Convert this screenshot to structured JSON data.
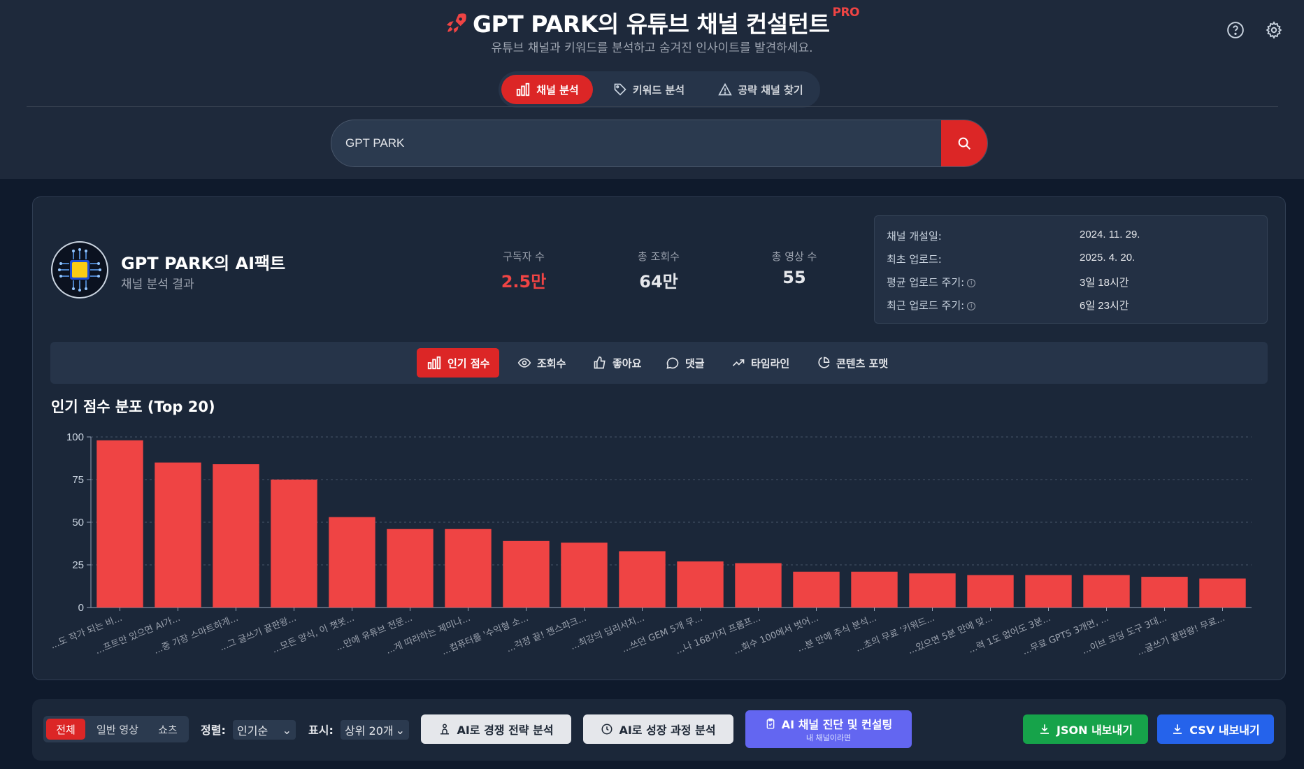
{
  "header": {
    "title": "GPT PARK의 유튜브 채널 컨설턴트",
    "pro_badge": "PRO",
    "subtitle": "유튜브 채널과 키워드를 분석하고 숨겨진 인사이트를 발견하세요.",
    "tabs": [
      {
        "label": "채널 분석",
        "icon": "bar-chart-icon",
        "active": true
      },
      {
        "label": "키워드 분석",
        "icon": "tag-icon",
        "active": false
      },
      {
        "label": "공략 채널 찾기",
        "icon": "warning-icon",
        "active": false
      }
    ],
    "icons": [
      "help-icon",
      "settings-icon"
    ]
  },
  "search": {
    "value": "GPT PARK"
  },
  "channel": {
    "name": "GPT PARK의 AI팩트",
    "subtitle": "채널 분석 결과",
    "stats": [
      {
        "label": "구독자 수",
        "value": "2.5만"
      },
      {
        "label": "총 조회수",
        "value": "64만"
      },
      {
        "label": "총 영상 수",
        "value": "55"
      }
    ],
    "info": [
      {
        "label": "채널 개설일:",
        "value": "2024. 11. 29."
      },
      {
        "label": "최초 업로드:",
        "value": "2025. 4. 20."
      },
      {
        "label": "평균 업로드 주기:",
        "value": "3일 18시간"
      },
      {
        "label": "최근 업로드 주기:",
        "value": "6일 23시간"
      }
    ]
  },
  "metric_tabs": [
    {
      "label": "인기 점수",
      "icon": "bar-chart-icon",
      "active": true
    },
    {
      "label": "조회수",
      "icon": "eye-icon",
      "active": false
    },
    {
      "label": "좋아요",
      "icon": "thumbs-up-icon",
      "active": false
    },
    {
      "label": "댓글",
      "icon": "comment-icon",
      "active": false
    },
    {
      "label": "타임라인",
      "icon": "trend-icon",
      "active": false
    },
    {
      "label": "콘텐츠 포맷",
      "icon": "pie-icon",
      "active": false
    }
  ],
  "chart_title": "인기 점수 분포 (Top 20)",
  "chart_data": {
    "type": "bar",
    "title": "인기 점수 분포 (Top 20)",
    "categories": [
      "...도 작가 되는 비...",
      "...프트만 있으면 AI가...",
      "...중 가장 스마트하게...",
      "...그 글쓰기 끝판왕...",
      "...모든 양식, 이 챗봇...",
      "...만에 유튜브 전문...",
      "...게 따라하는 제미나...",
      "...컴퓨터를 '수익형 소...",
      "...걱정 끝! 젠스파크...",
      "...최강의 딥리서치...",
      "...쓰던 GEM 5개 무...",
      "...나 168가지 프롬프...",
      "...회수 100에서 벗어...",
      "...분 만에 주식 분석...",
      "...초의 무료 '키워드...",
      "...있으면 5분 만에 맞...",
      "...력 1도 없어도 3분...",
      "...무료 GPTS 3개면, ...",
      "...이브 코딩 도구 3대...",
      "...글쓰기 끝판왕! 무료..."
    ],
    "values": [
      98,
      85,
      84,
      75,
      53,
      46,
      46,
      39,
      38,
      33,
      27,
      26,
      21,
      21,
      20,
      19,
      19,
      19,
      18,
      17
    ],
    "ylim": [
      0,
      100
    ],
    "yticks": [
      0,
      25,
      50,
      75,
      100
    ],
    "grid": true,
    "color": "#ef4444"
  },
  "toolbar": {
    "segments": [
      {
        "label": "전체",
        "active": true
      },
      {
        "label": "일반 영상",
        "active": false
      },
      {
        "label": "쇼츠",
        "active": false
      }
    ],
    "sort_label": "정렬:",
    "sort_value": "인기순",
    "display_label": "표시:",
    "display_value": "상위 20개",
    "buttons": {
      "competition": "AI로 경쟁 전략 분석",
      "growth": "AI로 성장 과정 분석",
      "diagnosis": "AI 채널 진단 및 컨설팅",
      "diagnosis_sub": "내 채널이라면",
      "json": "JSON 내보내기",
      "csv": "CSV 내보내기"
    }
  },
  "colors": {
    "accent": "#dc2626",
    "bg": "#0f1a2c",
    "panel": "#1b2739"
  }
}
